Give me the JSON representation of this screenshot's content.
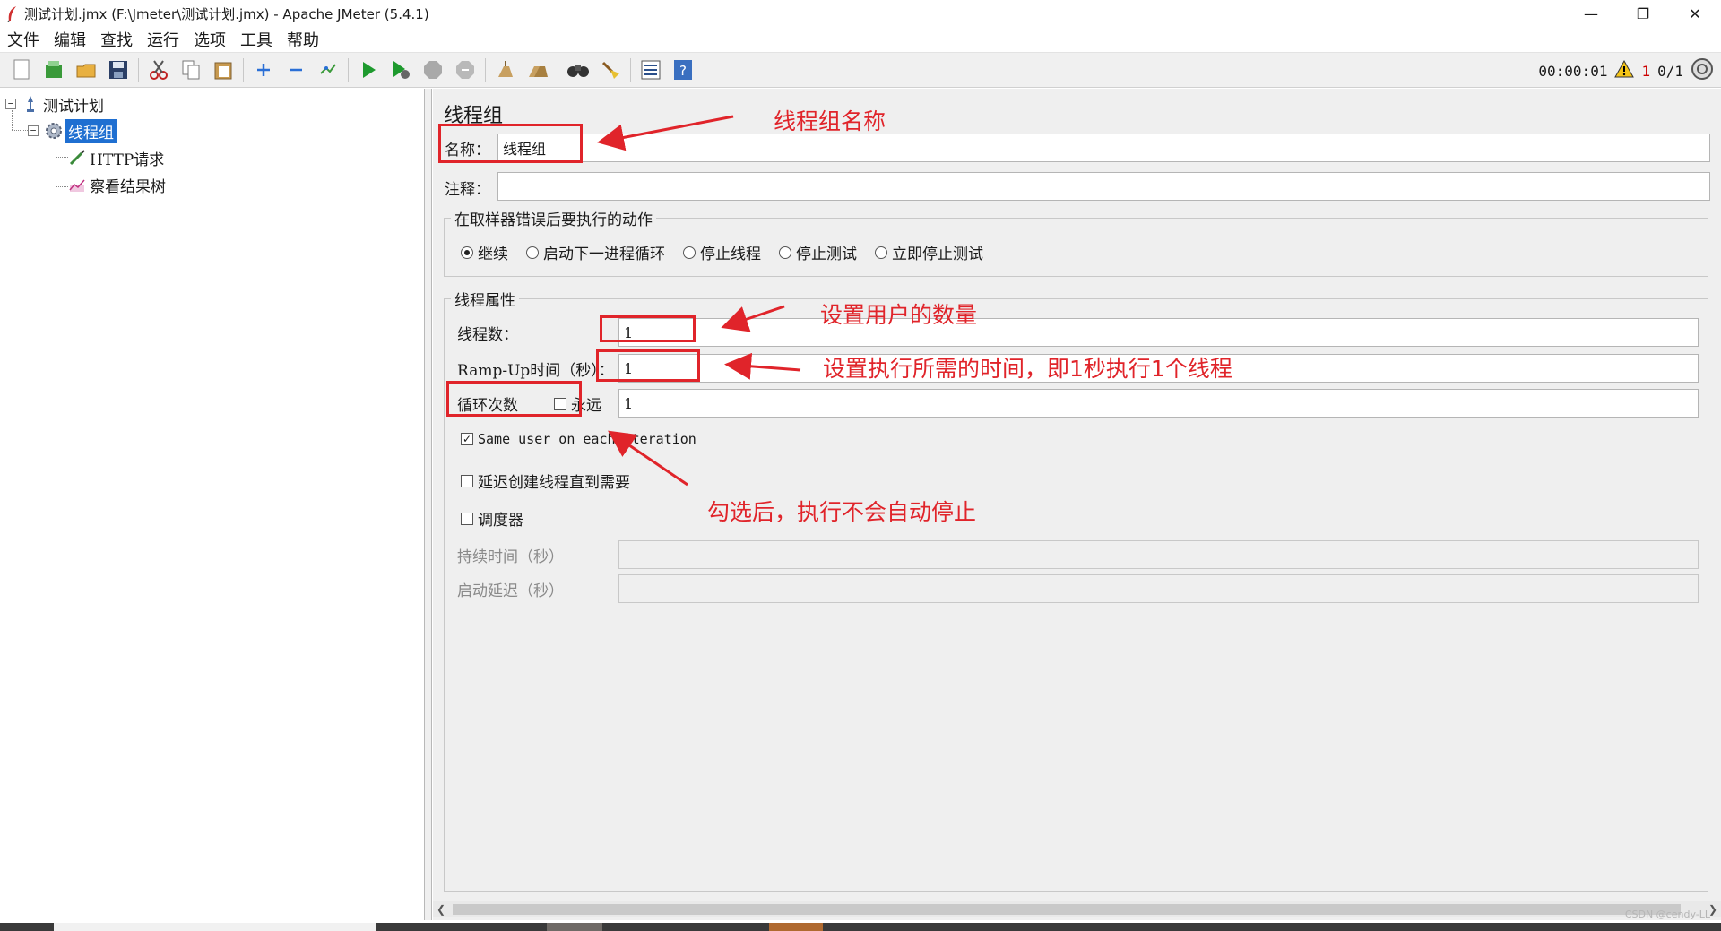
{
  "window": {
    "title": "测试计划.jmx (F:\\Jmeter\\测试计划.jmx) - Apache JMeter (5.4.1)",
    "minimize": "—",
    "maximize": "❐",
    "close": "✕"
  },
  "menu": [
    "文件",
    "编辑",
    "查找",
    "运行",
    "选项",
    "工具",
    "帮助"
  ],
  "toolbar": {
    "timer": "00:00:01",
    "warning_count": "1",
    "threads": "0/1"
  },
  "tree": {
    "root": "测试计划",
    "thread_group": "线程组",
    "http_request": "HTTP请求",
    "result_tree": "察看结果树"
  },
  "editor": {
    "title": "线程组",
    "name_label": "名称：",
    "name_value": "线程组",
    "comment_label": "注释：",
    "comment_value": "",
    "error_action_legend": "在取样器错误后要执行的动作",
    "error_actions": [
      "继续",
      "启动下一进程循环",
      "停止线程",
      "停止测试",
      "立即停止测试"
    ],
    "thread_props_legend": "线程属性",
    "threads_label": "线程数：",
    "threads_value": "1",
    "rampup_label": "Ramp-Up时间（秒）：",
    "rampup_value": "1",
    "loop_label": "循环次数",
    "forever_label": "永远",
    "loop_value": "1",
    "same_user_label": "Same user on each iteration",
    "delay_label": "延迟创建线程直到需要",
    "scheduler_label": "调度器",
    "duration_label": "持续时间（秒）",
    "startup_delay_label": "启动延迟（秒）"
  },
  "annotations": {
    "name": "线程组名称",
    "threads": "设置用户的数量",
    "rampup": "设置执行所需的时间，即1秒执行1个线程",
    "loop": "勾选后，执行不会自动停止"
  },
  "watermark": "CSDN @cendy-LL",
  "colors": {
    "annotation": "#e0242a",
    "selection": "#1f6fd1",
    "panel_bg": "#efefef"
  }
}
